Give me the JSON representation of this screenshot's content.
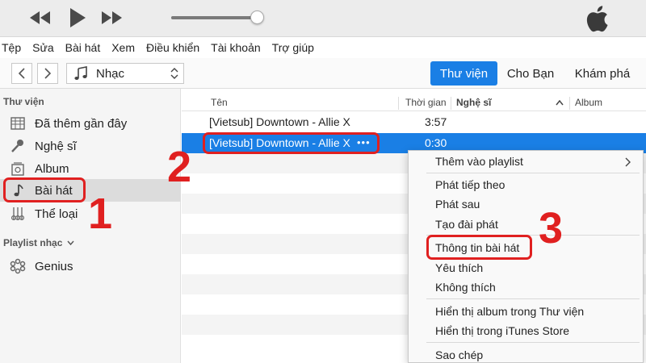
{
  "menubar": [
    "Tệp",
    "Sửa",
    "Bài hát",
    "Xem",
    "Điều khiển",
    "Tài khoản",
    "Trợ giúp"
  ],
  "player": {
    "volume": 0.95
  },
  "toolbar": {
    "media": "Nhạc",
    "tabs": [
      "Thư viện",
      "Cho Bạn",
      "Khám phá"
    ]
  },
  "sidebar": {
    "library_header": "Thư viện",
    "items": [
      {
        "label": "Đã thêm gần đây",
        "icon": "grid-icon"
      },
      {
        "label": "Nghệ sĩ",
        "icon": "microphone-icon"
      },
      {
        "label": "Album",
        "icon": "album-icon"
      },
      {
        "label": "Bài hát",
        "icon": "music-note-icon"
      },
      {
        "label": "Thể loại",
        "icon": "guitar-icon"
      }
    ],
    "playlist_header": "Playlist nhạc",
    "playlist_items": [
      {
        "label": "Genius",
        "icon": "genius-icon"
      }
    ]
  },
  "list": {
    "columns": [
      "Tên",
      "Thời gian",
      "Nghệ sĩ",
      "Album"
    ],
    "rows": [
      {
        "name": "[Vietsub] Downtown - Allie X",
        "time": "3:57"
      },
      {
        "name": "[Vietsub] Downtown - Allie X",
        "time": "0:30",
        "more": "•••"
      }
    ]
  },
  "context_menu": [
    "Thêm vào playlist",
    "Phát tiếp theo",
    "Phát sau",
    "Tạo đài phát",
    "Thông tin bài hát",
    "Yêu thích",
    "Không thích",
    "Hiển thị album trong Thư viện",
    "Hiển thị trong iTunes Store",
    "Sao chép"
  ],
  "annotations": [
    "1",
    "2",
    "3"
  ],
  "colors": {
    "accent": "#1a7fe5",
    "annotation": "#e02020"
  }
}
